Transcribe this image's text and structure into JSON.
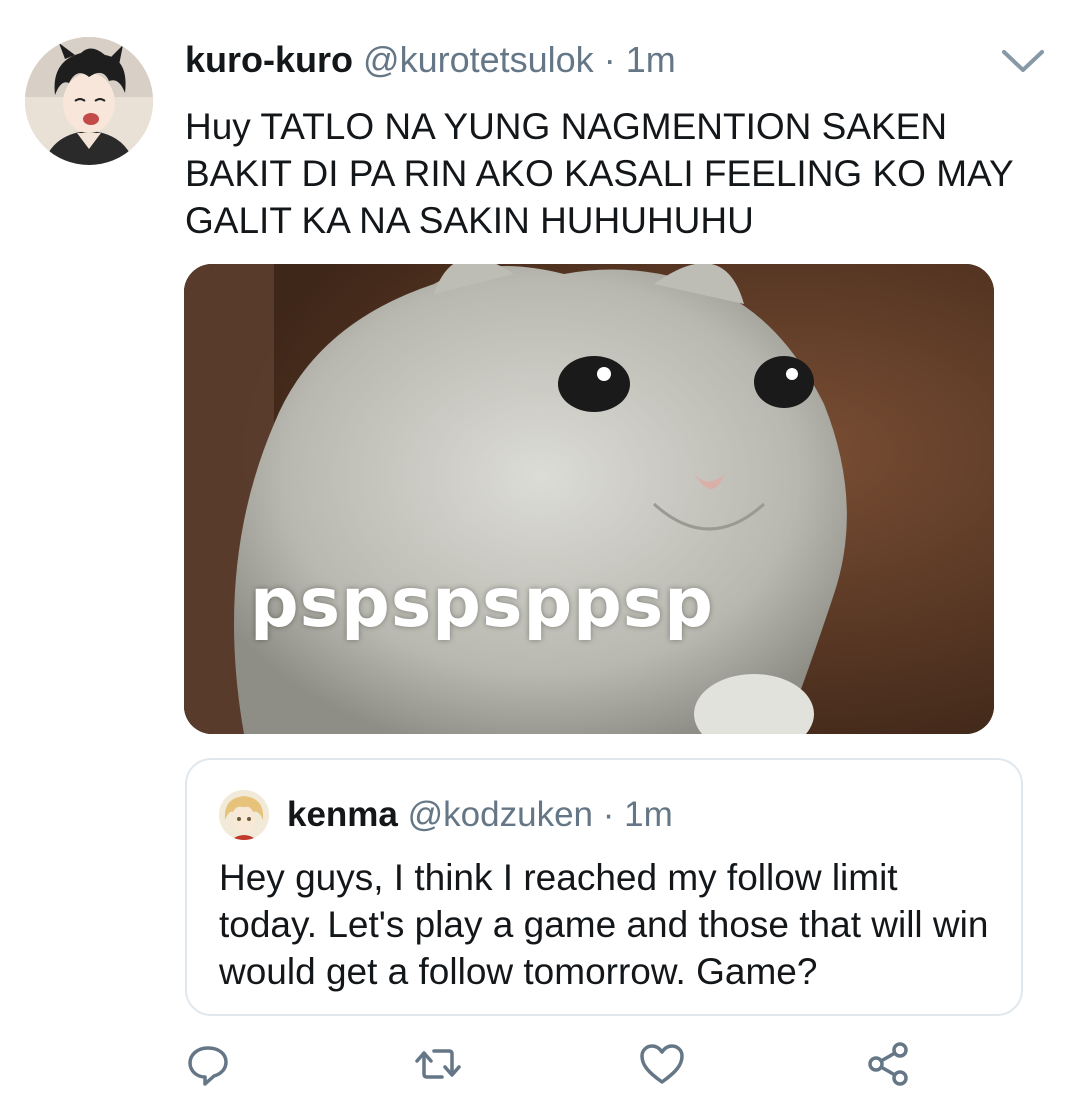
{
  "tweet": {
    "author_name": "kuro-kuro",
    "author_handle": "@kurotetsulok",
    "separator": "·",
    "time": "1m",
    "text": "Huy TATLO NA YUNG NAGMENTION SAKEN BAKIT DI PA RIN AKO KASALI FEELING KO MAY GALIT KA NA SAKIN HUHUHUHU",
    "media_caption": "pspspsppsp",
    "menu_icon": "chevron-down-icon"
  },
  "quoted_tweet": {
    "author_name": "kenma",
    "author_handle": "@kodzuken",
    "separator": "·",
    "time": "1m",
    "text": "Hey guys, I think I reached my follow limit today. Let's play a game and those that will win would get a follow tomorrow. Game?"
  },
  "actions": {
    "icons": [
      "reply-icon",
      "retweet-icon",
      "like-icon",
      "share-icon"
    ]
  },
  "colors": {
    "text": "#14171a",
    "secondary": "#657786",
    "border": "#e1e8ed"
  }
}
